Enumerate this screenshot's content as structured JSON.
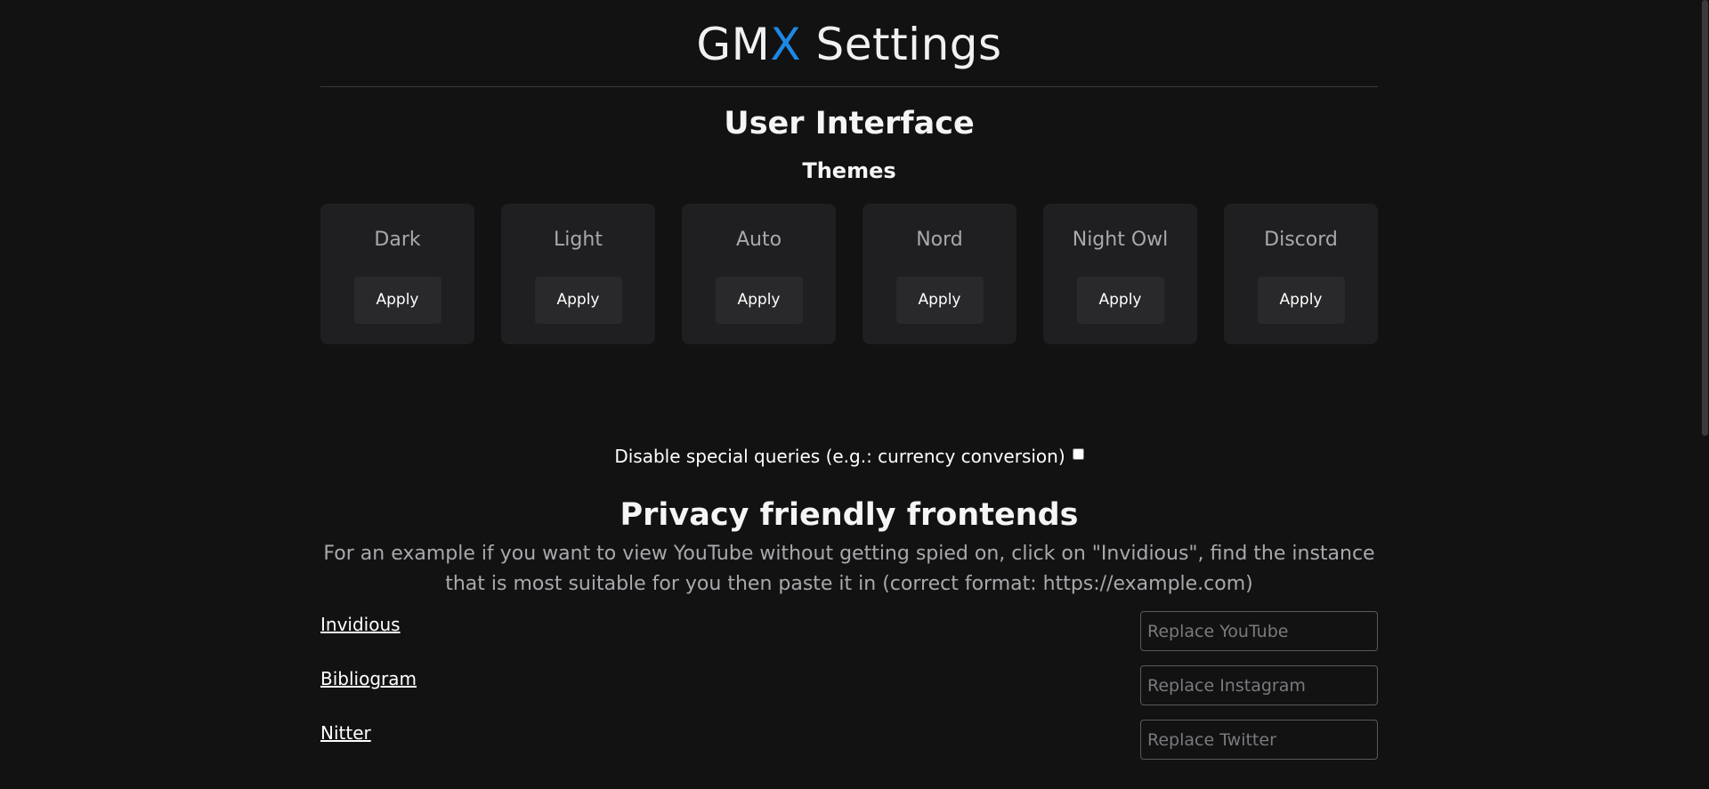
{
  "header": {
    "brand_prefix": "GM",
    "brand_accent": "X",
    "brand_suffix": " Settings",
    "accent_color": "#1e88e5"
  },
  "user_interface": {
    "title": "User Interface",
    "themes_title": "Themes",
    "themes": [
      {
        "name": "Dark",
        "button": "Apply"
      },
      {
        "name": "Light",
        "button": "Apply"
      },
      {
        "name": "Auto",
        "button": "Apply"
      },
      {
        "name": "Nord",
        "button": "Apply"
      },
      {
        "name": "Night Owl",
        "button": "Apply"
      },
      {
        "name": "Discord",
        "button": "Apply"
      }
    ],
    "special_queries_label": "Disable special queries (e.g.: currency conversion)",
    "special_queries_checked": false
  },
  "privacy": {
    "title": "Privacy friendly frontends",
    "description": "For an example if you want to view YouTube without getting spied on, click on \"Invidious\", find the instance that is most suitable for you then paste it in (correct format: https://example.com)",
    "frontends": [
      {
        "name": "Invidious",
        "placeholder": "Replace YouTube",
        "value": ""
      },
      {
        "name": "Bibliogram",
        "placeholder": "Replace Instagram",
        "value": ""
      },
      {
        "name": "Nitter",
        "placeholder": "Replace Twitter",
        "value": ""
      }
    ]
  },
  "colors": {
    "background": "#121213",
    "card": "#1f1f21",
    "button": "#29292c"
  }
}
